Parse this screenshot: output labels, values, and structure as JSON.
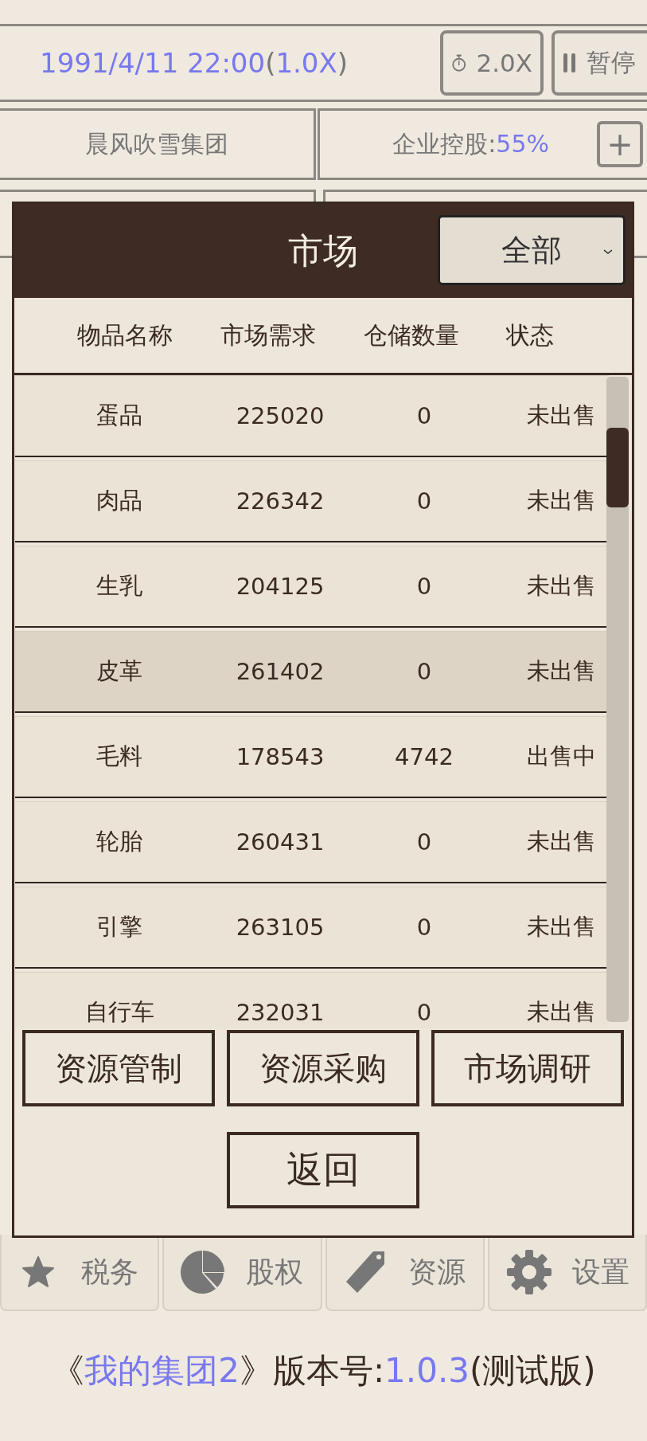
{
  "top_bar": {
    "datetime": [
      {
        "text": "1991/4/11 22:00",
        "accent": true
      },
      {
        "text": "(",
        "accent": false
      },
      {
        "text": "1.0X",
        "accent": true
      },
      {
        "text": ")",
        "accent": false
      }
    ],
    "speed_button": "2.0X",
    "pause_button": "暂停"
  },
  "company": {
    "name": "晨风吹雪集团",
    "holding": [
      {
        "text": "企业控股:",
        "accent": false
      },
      {
        "text": "55%",
        "accent": true
      }
    ],
    "add_button": "+"
  },
  "market_dialog": {
    "title": "市场",
    "filter": "全部",
    "columns": [
      "物品名称",
      "市场需求",
      "仓储数量",
      "状态"
    ],
    "rows": [
      {
        "name": "蛋品",
        "demand": "225020",
        "stock": "0",
        "status": "未出售",
        "selected": false
      },
      {
        "name": "肉品",
        "demand": "226342",
        "stock": "0",
        "status": "未出售",
        "selected": false
      },
      {
        "name": "生乳",
        "demand": "204125",
        "stock": "0",
        "status": "未出售",
        "selected": false
      },
      {
        "name": "皮革",
        "demand": "261402",
        "stock": "0",
        "status": "未出售",
        "selected": true
      },
      {
        "name": "毛料",
        "demand": "178543",
        "stock": "4742",
        "status": "出售中",
        "selected": false
      },
      {
        "name": "轮胎",
        "demand": "260431",
        "stock": "0",
        "status": "未出售",
        "selected": false
      },
      {
        "name": "引擎",
        "demand": "263105",
        "stock": "0",
        "status": "未出售",
        "selected": false
      },
      {
        "name": "自行车",
        "demand": "232031",
        "stock": "0",
        "status": "未出售",
        "selected": false
      }
    ],
    "action_buttons": [
      "资源管制",
      "资源采购",
      "市场调研"
    ],
    "back_button": "返回"
  },
  "bottom_nav": [
    {
      "kind": "star",
      "label": "税务"
    },
    {
      "kind": "pie",
      "label": "股权"
    },
    {
      "kind": "tag",
      "label": "资源"
    },
    {
      "kind": "gear",
      "label": "设置"
    }
  ],
  "footer": [
    {
      "text": "《",
      "accent": false
    },
    {
      "text": "我的集团2",
      "accent": true
    },
    {
      "text": "》版本号:",
      "accent": false
    },
    {
      "text": "1.0.3",
      "accent": true
    },
    {
      "text": "(测试版)",
      "accent": false
    }
  ]
}
